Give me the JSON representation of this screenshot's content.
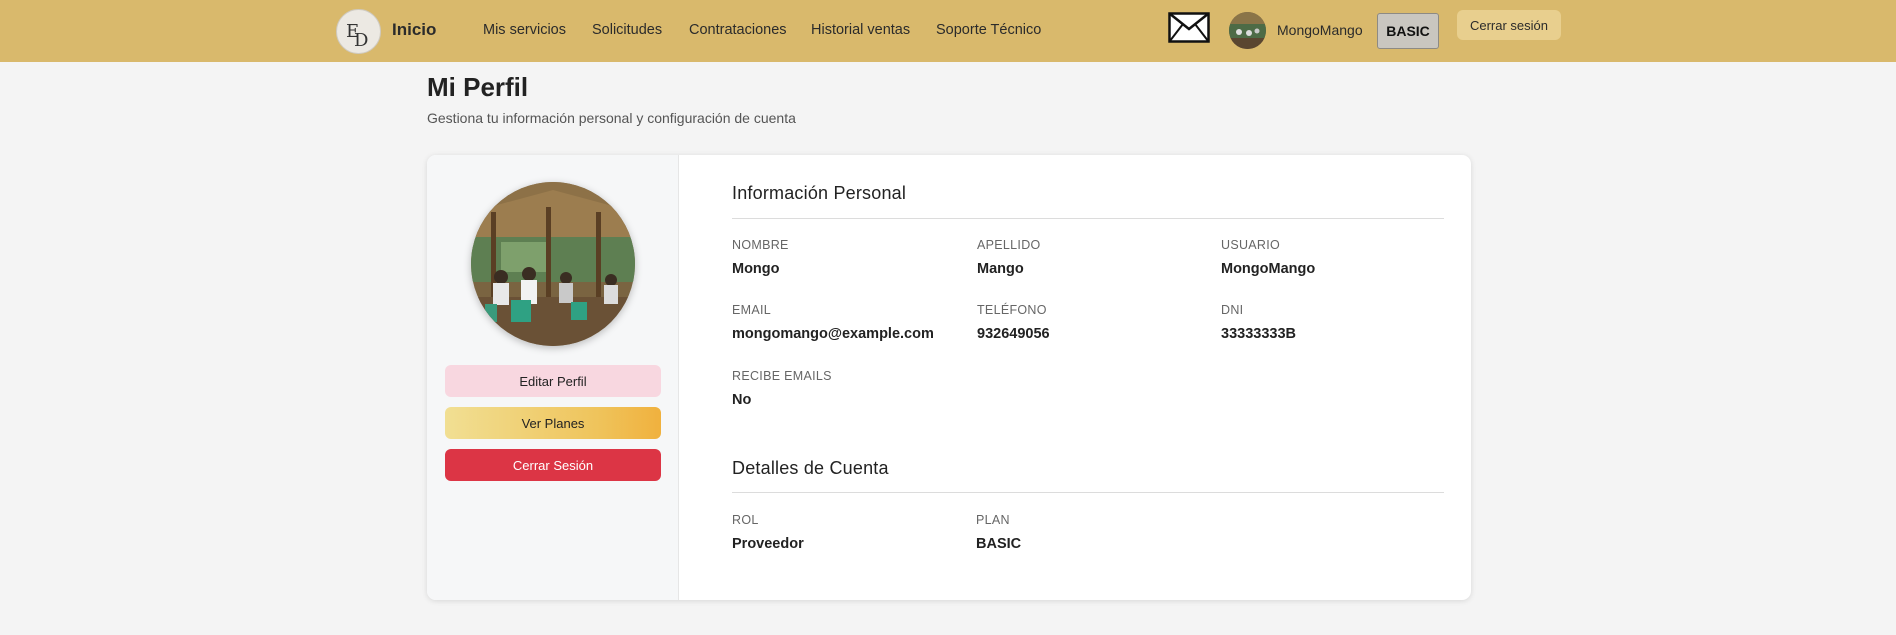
{
  "navbar": {
    "brand": "Inicio",
    "links": [
      "Mis servicios",
      "Solicitudes",
      "Contrataciones",
      "Historial ventas",
      "Soporte Técnico"
    ],
    "username": "MongoMango",
    "plan_badge": "BASIC",
    "logout_label": "Cerrar sesión",
    "bg_color": "#d9b96c"
  },
  "header": {
    "title": "Mi Perfil",
    "subtitle": "Gestiona tu información personal y configuración de cuenta"
  },
  "sidebar": {
    "edit_label": "Editar Perfil",
    "plans_label": "Ver Planes",
    "logout_label": "Cerrar Sesión"
  },
  "personal": {
    "title": "Información Personal",
    "fields": [
      {
        "label": "Nombre",
        "value": "Mongo"
      },
      {
        "label": "Apellido",
        "value": "Mango"
      },
      {
        "label": "Usuario",
        "value": "MongoMango"
      },
      {
        "label": "Email",
        "value": "mongomango@example.com"
      },
      {
        "label": "Teléfono",
        "value": "932649056"
      },
      {
        "label": "DNI",
        "value": "33333333B"
      },
      {
        "label": "Recibe Emails",
        "value": "No"
      }
    ]
  },
  "account": {
    "title": "Detalles de Cuenta",
    "fields": [
      {
        "label": "Rol",
        "value": "Proveedor"
      },
      {
        "label": "Plan",
        "value": "BASIC"
      }
    ]
  },
  "colors": {
    "accent": "#d9b96c",
    "danger": "#dc3545",
    "edit_button": "#f8d7e0"
  }
}
